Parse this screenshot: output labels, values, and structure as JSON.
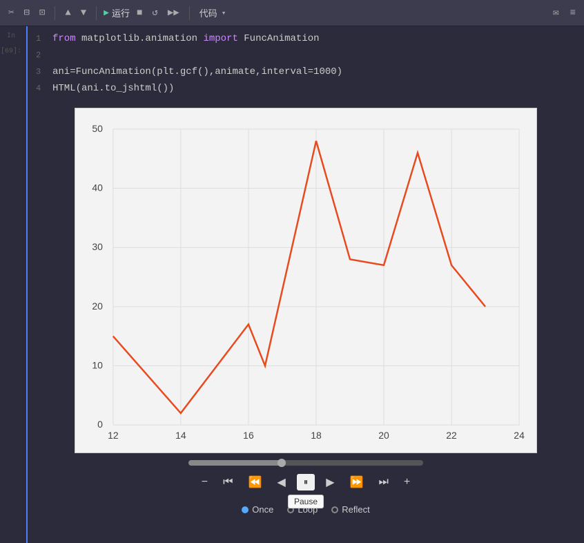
{
  "toolbar": {
    "icons": [
      "✂",
      "⊟",
      "⊡"
    ],
    "arrows": [
      "▲",
      "▼"
    ],
    "run_label": "运行",
    "stop_icon": "■",
    "refresh_icon": "↺",
    "skip_icon": "▶▶",
    "code_label": "代码",
    "dropdown_icon": "▾",
    "email_icon": "✉",
    "list_icon": "≡"
  },
  "gutter": {
    "label": "In [69]:",
    "line_numbers": [
      1,
      2,
      3,
      4
    ]
  },
  "code": [
    {
      "num": 1,
      "text": "from matplotlib.animation import FuncAnimation"
    },
    {
      "num": 2,
      "text": ""
    },
    {
      "num": 3,
      "text": "ani=FuncAnimation(plt.gcf(),animate,interval=1000)"
    },
    {
      "num": 4,
      "text": "HTML(ani.to_jshtml())"
    }
  ],
  "chart": {
    "x_labels": [
      "12",
      "14",
      "16",
      "18",
      "20",
      "22",
      "24"
    ],
    "y_labels": [
      "0",
      "10",
      "20",
      "30",
      "40",
      "50"
    ],
    "data_points": [
      {
        "x": 12,
        "y": 15
      },
      {
        "x": 14,
        "y": 2
      },
      {
        "x": 16,
        "y": 17
      },
      {
        "x": 16.5,
        "y": 10
      },
      {
        "x": 18,
        "y": 48
      },
      {
        "x": 19,
        "y": 28
      },
      {
        "x": 20,
        "y": 27
      },
      {
        "x": 21,
        "y": 46
      },
      {
        "x": 22,
        "y": 27
      },
      {
        "x": 23,
        "y": 20
      }
    ],
    "line_color": "#e84a20",
    "grid_color": "#ddd"
  },
  "controls": {
    "minus_label": "−",
    "skip_start_label": "⏮",
    "prev_label": "⏮",
    "back_label": "◀",
    "pause_label": "⏸",
    "play_label": "▶",
    "next_label": "⏭",
    "skip_end_label": "⏭",
    "plus_label": "+",
    "tooltip": "Pause",
    "playback_options": [
      "Once",
      "Loop",
      "Reflect"
    ],
    "selected_option": "Once"
  }
}
